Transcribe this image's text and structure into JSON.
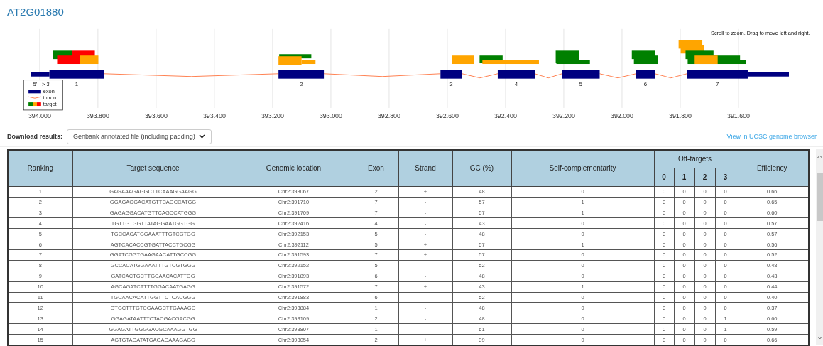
{
  "title": "AT2G01880",
  "gene_view": {
    "hint": "Scroll to zoom. Drag to move left and right.",
    "axis_labels": [
      "394.000",
      "393.800",
      "393.600",
      "393.400",
      "393.200",
      "393.000",
      "392.800",
      "392.600",
      "392.400",
      "392.200",
      "392.000",
      "391.800",
      "391.600"
    ],
    "exon_labels": [
      "1",
      "2",
      "3",
      "4",
      "5",
      "6",
      "7"
    ],
    "legend": {
      "title": "5' --> 3'",
      "items": [
        {
          "kind": "exon",
          "label": "exon"
        },
        {
          "kind": "intron",
          "label": "intron"
        },
        {
          "kind": "target",
          "label": "target"
        }
      ]
    }
  },
  "download": {
    "label": "Download results:",
    "value": "Genbank annotated file (including padding)"
  },
  "ucsc_link": "View in UCSC genome browser",
  "table": {
    "columns": [
      "Ranking",
      "Target sequence",
      "Genomic location",
      "Exon",
      "Strand",
      "GC (%)",
      "Self-complementarity"
    ],
    "group_column": "Off-targets",
    "sub_columns": [
      "0",
      "1",
      "2",
      "3"
    ],
    "last_column": "Efficiency",
    "rows": [
      [
        "1",
        "GAGAAAGAGGCTTCAAAGGAAGG",
        "Chr2:393067",
        "2",
        "+",
        "48",
        "0",
        "0",
        "0",
        "0",
        "0",
        "0.66"
      ],
      [
        "2",
        "GGAGAGGACATGTTCAGCCATGG",
        "Chr2:391710",
        "7",
        "-",
        "57",
        "1",
        "0",
        "0",
        "0",
        "0",
        "0.65"
      ],
      [
        "3",
        "GAGAGGACATGTTCAGCCATGGG",
        "Chr2:391709",
        "7",
        "-",
        "57",
        "1",
        "0",
        "0",
        "0",
        "0",
        "0.60"
      ],
      [
        "4",
        "TGTTGTGGTTATAGGAATGGTGG",
        "Chr2:392416",
        "4",
        "-",
        "43",
        "0",
        "0",
        "0",
        "0",
        "0",
        "0.57"
      ],
      [
        "5",
        "TGCCACATGGAAATTTGTCGTGG",
        "Chr2:392153",
        "5",
        "-",
        "48",
        "0",
        "0",
        "0",
        "0",
        "0",
        "0.57"
      ],
      [
        "6",
        "AGTCACACCGTGATTACCTGCGG",
        "Chr2:392112",
        "5",
        "+",
        "57",
        "1",
        "0",
        "0",
        "0",
        "0",
        "0.56"
      ],
      [
        "7",
        "GGATCGGTGAAGAACATTGCCGG",
        "Chr2:391593",
        "7",
        "+",
        "57",
        "0",
        "0",
        "0",
        "0",
        "0",
        "0.52"
      ],
      [
        "8",
        "GCCACATGGAAATTTGTCGTGGG",
        "Chr2:392152",
        "5",
        "-",
        "52",
        "0",
        "0",
        "0",
        "0",
        "0",
        "0.48"
      ],
      [
        "9",
        "GATCACTGCTTGCAACACATTGG",
        "Chr2:391893",
        "6",
        "-",
        "48",
        "0",
        "0",
        "0",
        "0",
        "0",
        "0.43"
      ],
      [
        "10",
        "AGCAGATCTTTTGGACAATGAGG",
        "Chr2:391572",
        "7",
        "+",
        "43",
        "1",
        "0",
        "0",
        "0",
        "0",
        "0.44"
      ],
      [
        "11",
        "TGCAACACATTGGTTCTCACGGG",
        "Chr2:391883",
        "6",
        "-",
        "52",
        "0",
        "0",
        "0",
        "0",
        "0",
        "0.40"
      ],
      [
        "12",
        "GTGCTTTGTCGAAGCTTGAAAGG",
        "Chr2:393884",
        "1",
        "-",
        "48",
        "0",
        "0",
        "0",
        "0",
        "0",
        "0.37"
      ],
      [
        "13",
        "GGAGATAATTTCTACGACGACGG",
        "Chr2:393109",
        "2",
        "-",
        "48",
        "0",
        "0",
        "0",
        "0",
        "1",
        "0.60"
      ],
      [
        "14",
        "GGAGATTGGGGACGCAAAGGTGG",
        "Chr2:393807",
        "1",
        "-",
        "61",
        "0",
        "0",
        "0",
        "0",
        "1",
        "0.59"
      ],
      [
        "15",
        "AGTGTAGATATGAGAGAAAGAGG",
        "Chr2:393054",
        "2",
        "+",
        "39",
        "0",
        "0",
        "0",
        "0",
        "0",
        "0.66"
      ]
    ]
  }
}
